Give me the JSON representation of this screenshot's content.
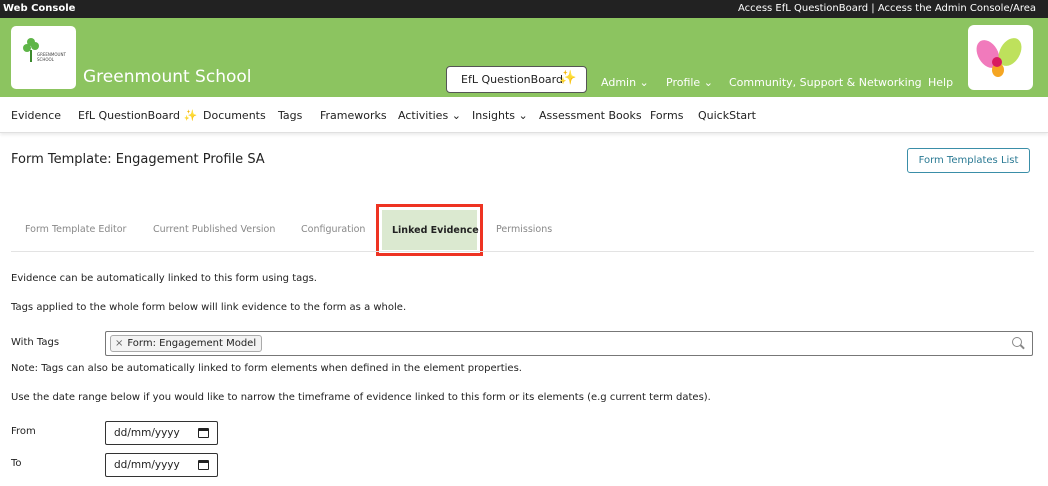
{
  "topbar": {
    "title": "Web Console",
    "right_links": "Access EfL QuestionBoard | Access the Admin Console/Area"
  },
  "banner": {
    "logo_text": "GREENMOUNT SCHOOL",
    "school_name": "Greenmount School",
    "questionboard_label": "EfL QuestionBoard",
    "questionboard_icon": "magic-wand-icon",
    "nav": {
      "admin": "Admin",
      "profile": "Profile",
      "community": "Community, Support & Networking",
      "help": "Help"
    }
  },
  "nav": {
    "items": [
      "Evidence",
      "EfL QuestionBoard",
      "Documents",
      "Tags",
      "Frameworks",
      "Activities",
      "Insights",
      "Assessment Books",
      "Forms",
      "QuickStart"
    ]
  },
  "page": {
    "title": "Form Template: Engagement Profile SA",
    "templates_list_button": "Form Templates List"
  },
  "tabs": {
    "items": [
      "Form Template Editor",
      "Current Published Version",
      "Configuration",
      "Linked Evidence",
      "Permissions"
    ],
    "active": "Linked Evidence"
  },
  "content": {
    "p1": "Evidence can be automatically linked to this form using tags.",
    "p2": "Tags applied to the whole form below will link evidence to the form as a whole.",
    "with_tags_label": "With Tags",
    "tag_chip": "Form: Engagement Model",
    "note": "Note: Tags can also be automatically linked to form elements when defined in the element properties.",
    "date_instructions": "Use the date range below if you would like to narrow the timeframe of evidence linked to this form or its elements (e.g current term dates).",
    "from_label": "From",
    "to_label": "To",
    "from_placeholder": "dd/mm/yyyy",
    "to_placeholder": "dd/mm/yyyy"
  },
  "colors": {
    "banner_green": "#8cc460",
    "active_tab_bg": "#dbe9d0",
    "highlight_red": "#ee3322",
    "button_teal": "#2b7a94"
  }
}
